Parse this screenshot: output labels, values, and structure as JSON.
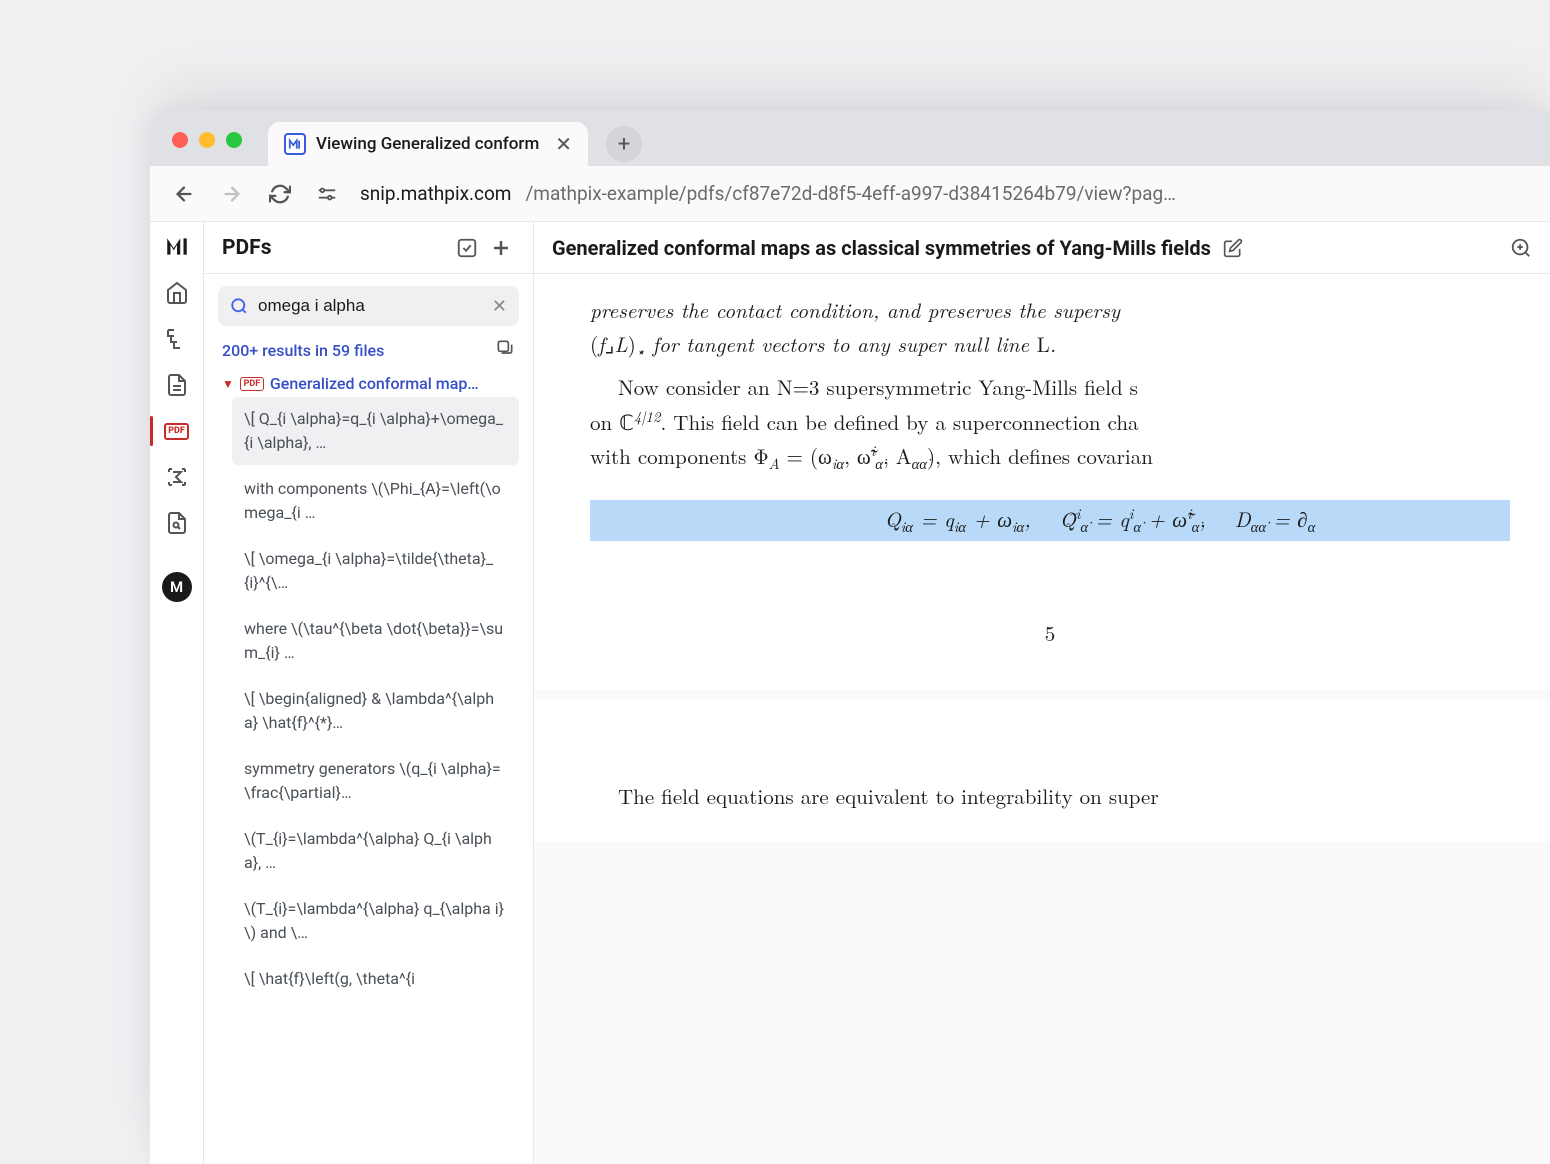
{
  "browser": {
    "tab_title": "Viewing Generalized conform",
    "favicon_letter": "⌐⌐",
    "url_domain": "snip.mathpix.com",
    "url_path": "/mathpix-example/pdfs/cf87e72d-d8f5-4eff-a997-d38415264b79/view?pag…"
  },
  "sidebar": {
    "title": "PDFs",
    "search_value": "omega i alpha",
    "results_summary": "200+ results in 59 files",
    "file_name": "Generalized conformal map…",
    "file_icon_label": "PDF",
    "items": [
      "\\[ Q_{i \\alpha}=q_{i \\alpha}+\\omega_{i \\alpha}, …",
      "with components \\(\\Phi_{A}=\\left(\\omega_{i …",
      "\\[ \\omega_{i \\alpha}=\\tilde{\\theta}_{i}^{\\…",
      "where \\(\\tau^{\\beta \\dot{\\beta}}=\\sum_{i} …",
      "\\[ \\begin{aligned} & \\lambda^{\\alpha} \\hat{f}^{*}…",
      "symmetry generators \\(q_{i \\alpha}=\\frac{\\partial}…",
      "\\(T_{i}=\\lambda^{\\alpha} Q_{i \\alpha}, …",
      "\\(T_{i}=\\lambda^{\\alpha} q_{\\alpha i}\\) and \\…",
      "\\[ \\hat{f}\\left(g, \\theta^{i"
    ]
  },
  "document": {
    "title": "Generalized conformal maps as classical symmetries of Yang-Mills fields",
    "para1": "preserves the contact condition, and preserves the supersy",
    "para1_line2": "(f⌟L)⋆ for tangent vectors to any super null line L.",
    "para2_part1": "Now consider an N=3 supersymmetric Yang-Mills field s",
    "para2_part2": "on ℂ",
    "para2_exp": "4|12",
    "para2_part3": ". This field can be defined by a superconnection cha",
    "para2_part4": "with components Φ",
    "para2_sub_a": "A",
    "para2_part5": " = (ω",
    "para2_sub_ia": "iα",
    "para2_part6": ", ω̃",
    "para2_sup_i": "i",
    "para2_sub_alpha": "α̇",
    "para2_part7": ", A",
    "para2_sub_aa": "αα̇",
    "para2_part8": "), which defines covarian",
    "equation": "Q_{iα} = q_{iα} + ω_{iα},  Q̃^{i}_{α̇} = q^{i}_{α̇} + ω̃^{i}_{α̇},  D_{αα̇} = ∂_{α}",
    "page_number": "5",
    "para3": "The field equations are equivalent to integrability on super"
  },
  "rail": {
    "avatar_letter": "M",
    "pdf_label": "PDF"
  }
}
